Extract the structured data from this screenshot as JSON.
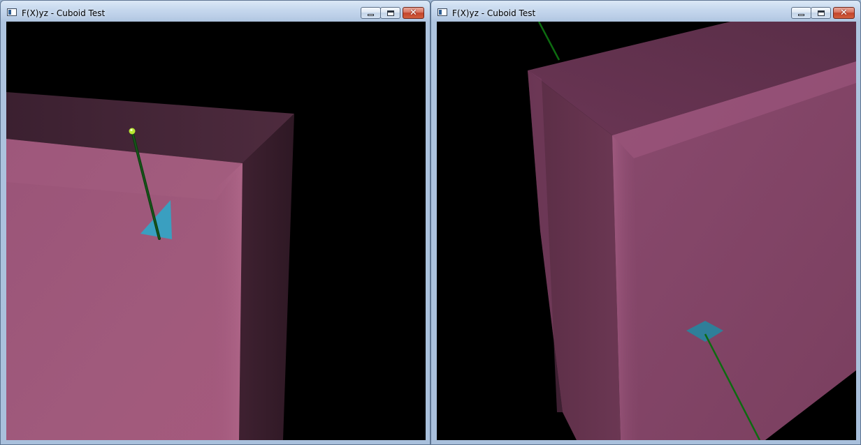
{
  "windows": [
    {
      "title": "F(X)yz - Cuboid Test",
      "icon": "app-window-icon",
      "controls": {
        "minimize_icon": "minimize-icon",
        "maximize_icon": "maximize-icon",
        "close_icon": "close-icon",
        "close_glyph": "✕"
      }
    },
    {
      "title": "F(X)yz - Cuboid Test",
      "icon": "app-window-icon",
      "controls": {
        "minimize_icon": "minimize-icon",
        "maximize_icon": "maximize-icon",
        "close_icon": "close-icon",
        "close_glyph": "✕"
      }
    }
  ],
  "colors": {
    "viewport_background": "#000000",
    "cuboid_pink": "#a0587a",
    "axis_line_green": "#0d6b10",
    "triangle_cyan": "#3a9fc0",
    "endpoint_yellow_green": "#b8e832",
    "titlebar_blue": "#b9cde6",
    "close_button_red": "#c2432b"
  }
}
